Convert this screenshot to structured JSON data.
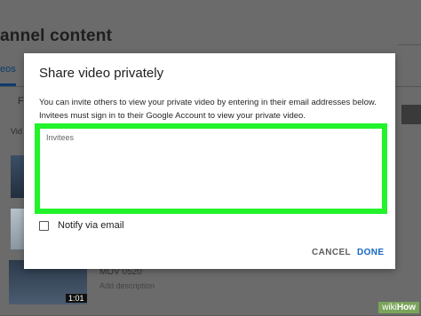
{
  "background": {
    "page_title": "annel content",
    "tab_label": "eos",
    "filter_label": "F",
    "column_label": "Vid",
    "video_name": "MOV 0520",
    "video_description": "Add description",
    "video_duration": "1:01"
  },
  "dialog": {
    "title": "Share video privately",
    "description": "You can invite others to view your private video by entering in their email addresses below. Invitees must sign in to their Google Account to view your private video.",
    "invitees_placeholder": "Invitees",
    "invitees_value": "",
    "notify_label": "Notify via email",
    "notify_checked": false,
    "cancel_label": "CANCEL",
    "done_label": "DONE"
  },
  "colors": {
    "highlight": "#22f32a",
    "done_accent": "#1565c0",
    "overlay": "#6b6b6b"
  },
  "watermark": {
    "wiki": "wiki",
    "how": "How"
  }
}
